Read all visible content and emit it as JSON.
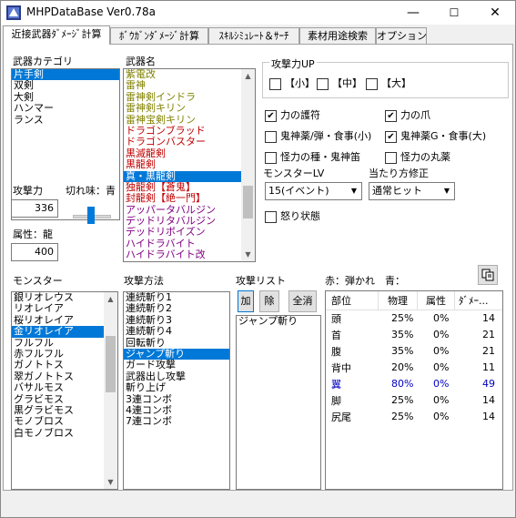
{
  "window": {
    "title": "MHPDataBase Ver0.78a",
    "minimize": "—",
    "maximize": "☐",
    "close": "✕"
  },
  "tabs": [
    {
      "label": "近接武器ﾀﾞﾒｰｼﾞ計算"
    },
    {
      "label": "ﾎﾞｳｶﾞﾝﾀﾞﾒｰｼﾞ計算"
    },
    {
      "label": "ｽｷﾙｼﾐｭﾚｰﾄ＆ｻｰﾁ"
    },
    {
      "label": "素材用途検索"
    },
    {
      "label": "オプション"
    }
  ],
  "weapon_category": {
    "label": "武器カテゴリ",
    "items": [
      "片手剣",
      "双剣",
      "大剣",
      "ハンマー",
      "ランス"
    ],
    "selected": "片手剣"
  },
  "weapon_name": {
    "label": "武器名",
    "items": [
      {
        "text": "紫電改",
        "color": "#808000"
      },
      {
        "text": "雷神",
        "color": "#808000"
      },
      {
        "text": "雷神剣インドラ",
        "color": "#808000"
      },
      {
        "text": "雷神剣キリン",
        "color": "#808000"
      },
      {
        "text": "雷神宝剣キリン",
        "color": "#808000"
      },
      {
        "text": "ドラゴンブラッド",
        "color": "#c00000"
      },
      {
        "text": "ドラゴンバスター",
        "color": "#c00000"
      },
      {
        "text": "黒滅龍剣",
        "color": "#c00000"
      },
      {
        "text": "黒龍剣",
        "color": "#c00000"
      },
      {
        "text": "真・黒龍剣",
        "color": "#c00000"
      },
      {
        "text": "独龍剣【蒼鬼】",
        "color": "#c00000"
      },
      {
        "text": "封龍剣【絶一門】",
        "color": "#c00000"
      },
      {
        "text": "アッパータバルジン",
        "color": "#800080"
      },
      {
        "text": "デッドリタバルジン",
        "color": "#800080"
      },
      {
        "text": "デッドリポイズン",
        "color": "#800080"
      },
      {
        "text": "ハイドラバイト",
        "color": "#800080"
      },
      {
        "text": "ハイドラバイト改",
        "color": "#800080"
      }
    ],
    "selected": "真・黒龍剣"
  },
  "attack": {
    "label": "攻撃力",
    "value": "336"
  },
  "sharpness": {
    "label": "切れ味：青"
  },
  "element": {
    "label": "属性：龍",
    "value": "400"
  },
  "attack_up": {
    "label": "攻撃力UP",
    "options": [
      {
        "label": "【小】",
        "checked": false
      },
      {
        "label": "【中】",
        "checked": false
      },
      {
        "label": "【大】",
        "checked": false
      }
    ]
  },
  "options": [
    {
      "label": "力の護符",
      "checked": true
    },
    {
      "label": "力の爪",
      "checked": true
    },
    {
      "label": "鬼神薬/弾・食事(小)",
      "checked": false
    },
    {
      "label": "鬼神薬G・食事(大)",
      "checked": true
    },
    {
      "label": "怪力の種・鬼神笛",
      "checked": false
    },
    {
      "label": "怪力の丸薬",
      "checked": false
    }
  ],
  "monster_lv": {
    "label": "モンスターLV",
    "value": "15(イベント)"
  },
  "hit_correction": {
    "label": "当たり方修正",
    "value": "通常ヒット"
  },
  "rage": {
    "label": "怒り状態",
    "checked": false
  },
  "monster": {
    "label": "モンスター",
    "items": [
      "銀リオレウス",
      "リオレイア",
      "桜リオレイア",
      "金リオレイア",
      "フルフル",
      "赤フルフル",
      "ガノトトス",
      "翠ガノトトス",
      "バサルモス",
      "グラビモス",
      "黒グラビモス",
      "モノブロス",
      "白モノブロス"
    ],
    "selected": "金リオレイア"
  },
  "attack_method": {
    "label": "攻撃方法",
    "items": [
      "連続斬り1",
      "連続斬り2",
      "連続斬り3",
      "連続斬り4",
      "回転斬り",
      "ジャンプ斬り",
      "ガード攻撃",
      "武器出し攻撃",
      "斬り上げ",
      "3連コンボ",
      "4連コンボ",
      "7連コンボ"
    ],
    "selected": "ジャンプ斬り"
  },
  "attack_list": {
    "label": "攻撃リスト",
    "add": "加",
    "remove": "除",
    "clear": "全消",
    "items": [
      "ジャンプ斬り"
    ]
  },
  "result_legend": "赤：弾かれ　青：",
  "copy_icon": "copy-icon",
  "result_table": {
    "headers": [
      "部位",
      "物理",
      "属性",
      "ﾀﾞﾒｰ..."
    ],
    "rows": [
      {
        "part": "頭",
        "phys": "25%",
        "elem": "0%",
        "dmg": "14",
        "color": "#000000"
      },
      {
        "part": "首",
        "phys": "35%",
        "elem": "0%",
        "dmg": "21",
        "color": "#000000"
      },
      {
        "part": "腹",
        "phys": "35%",
        "elem": "0%",
        "dmg": "21",
        "color": "#000000"
      },
      {
        "part": "背中",
        "phys": "20%",
        "elem": "0%",
        "dmg": "11",
        "color": "#000000"
      },
      {
        "part": "翼",
        "phys": "80%",
        "elem": "0%",
        "dmg": "49",
        "color": "#0000c0"
      },
      {
        "part": "脚",
        "phys": "25%",
        "elem": "0%",
        "dmg": "14",
        "color": "#000000"
      },
      {
        "part": "尻尾",
        "phys": "25%",
        "elem": "0%",
        "dmg": "14",
        "color": "#000000"
      }
    ]
  }
}
